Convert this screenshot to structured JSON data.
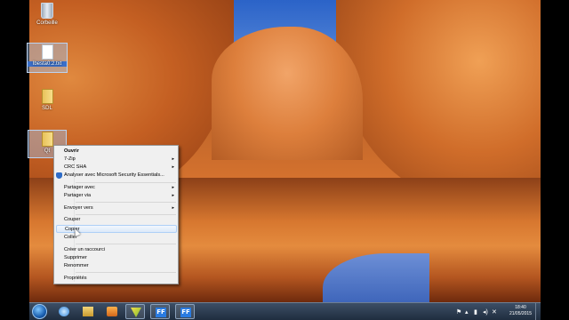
{
  "desktop": {
    "icons": [
      {
        "label": "Corbeille"
      },
      {
        "label": "Ibesta0.2.txt"
      },
      {
        "label": "SDL"
      },
      {
        "label": "Qt"
      }
    ]
  },
  "context_menu": {
    "items": [
      {
        "label": "Ouvrir",
        "bold": true
      },
      {
        "label": "7-Zip",
        "submenu": true
      },
      {
        "label": "CRC SHA",
        "submenu": true
      },
      {
        "label": "Analyser avec Microsoft Security Essentials..."
      },
      {
        "label": "Partager avec",
        "submenu": true
      },
      {
        "label": "Partager via",
        "submenu": true
      },
      {
        "label": "Envoyer vers",
        "submenu": true
      },
      {
        "label": "Couper"
      },
      {
        "label": "Copier",
        "hovered": true
      },
      {
        "label": "Coller"
      },
      {
        "label": "Créer un raccourci"
      },
      {
        "label": "Supprimer"
      },
      {
        "label": "Renommer"
      },
      {
        "label": "Propriétés"
      }
    ],
    "submenu_arrow": "▸"
  },
  "taskbar": {
    "pinned": [
      {
        "icon": "internet-explorer-icon"
      },
      {
        "icon": "file-explorer-icon"
      },
      {
        "icon": "media-player-icon"
      },
      {
        "icon": "app-icon"
      },
      {
        "icon": "ff-app-icon",
        "text": "FF"
      },
      {
        "icon": "ff-app-icon",
        "text": "FF"
      }
    ],
    "tray": {
      "flag": "⚑",
      "up_arrow": "▴",
      "network": "▮",
      "volume": "◂)",
      "extra": "✕"
    },
    "clock": {
      "time": "18:40",
      "date": "21/05/2015"
    }
  }
}
